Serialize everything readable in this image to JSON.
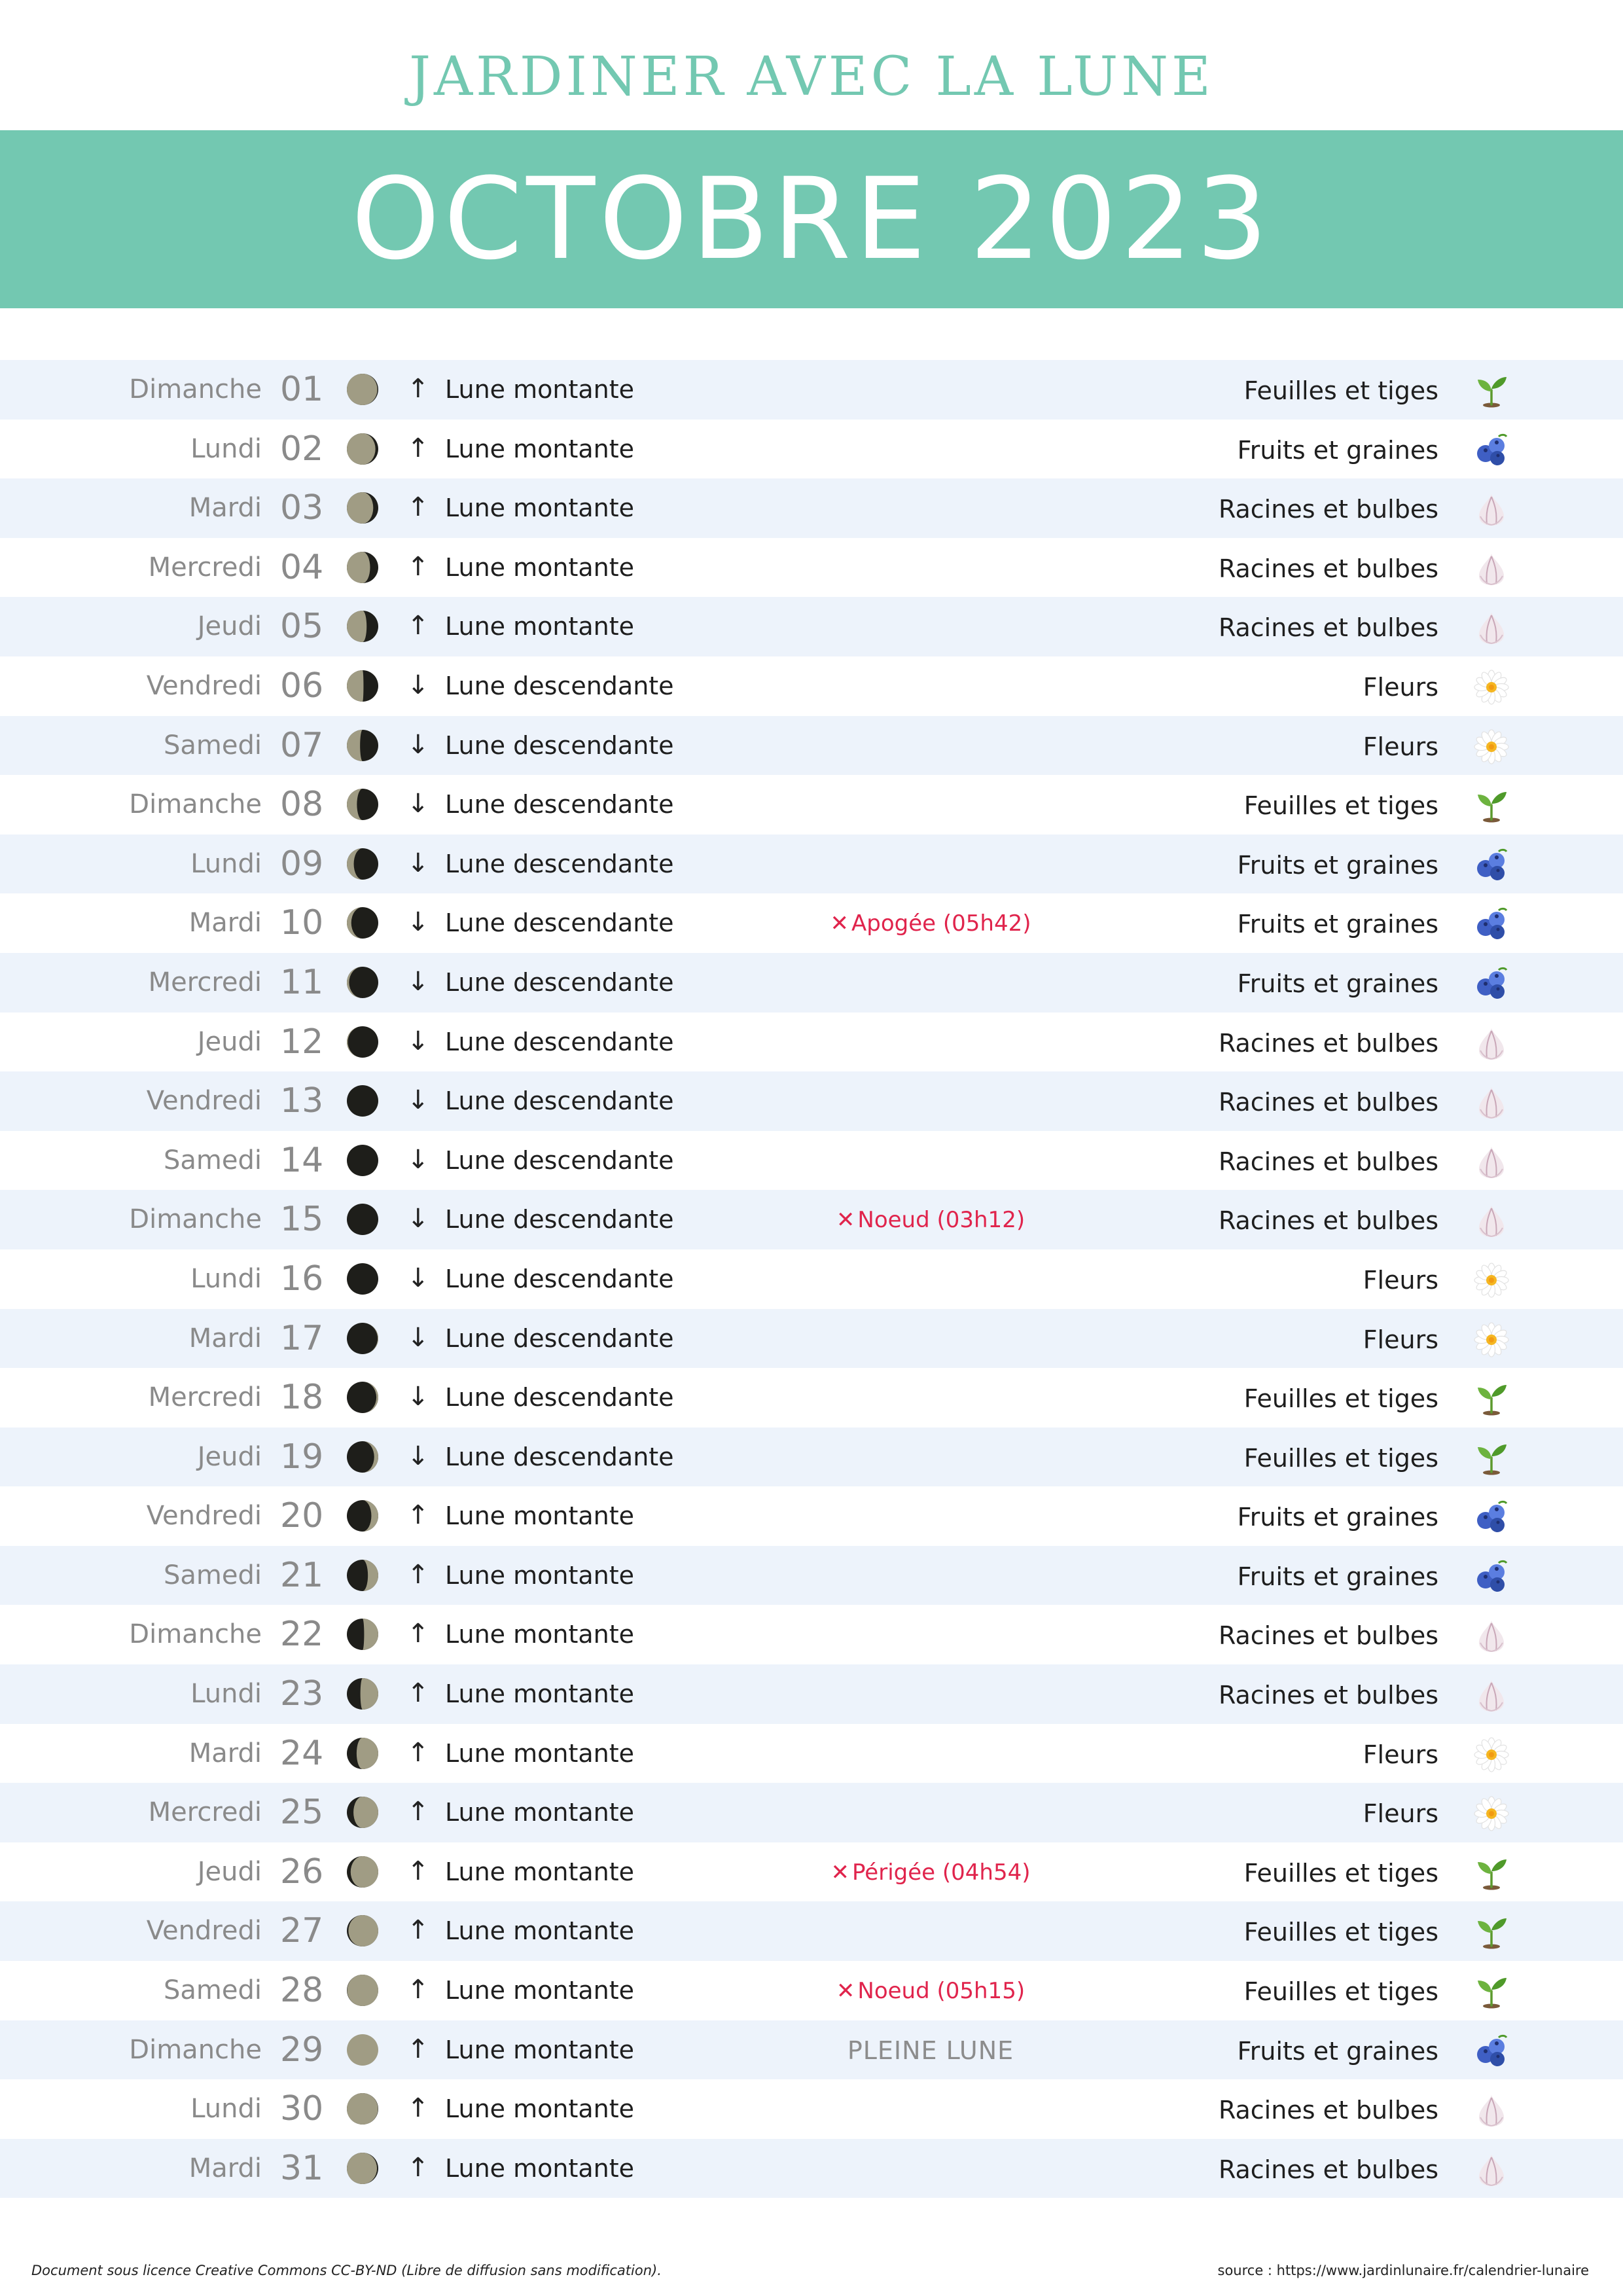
{
  "header": {
    "subtitle": "JARDINER AVEC LA LUNE",
    "title": "OCTOBRE 2023"
  },
  "colors": {
    "accent": "#73c8b1",
    "row_shade": "#edf3fb",
    "event_red": "#e0244c",
    "moon_light": "#a09c84",
    "moon_dark": "#1e1e1a"
  },
  "days": [
    {
      "weekday": "Dimanche",
      "day": "01",
      "moon_light_fraction": 0.97,
      "moon_waxing": false,
      "arrow": "↑",
      "movement": "Lune montante",
      "event": "",
      "category": "Feuilles et tiges",
      "icon": "sprout-icon"
    },
    {
      "weekday": "Lundi",
      "day": "02",
      "moon_light_fraction": 0.91,
      "moon_waxing": false,
      "arrow": "↑",
      "movement": "Lune montante",
      "event": "",
      "category": "Fruits et graines",
      "icon": "blueberries-icon"
    },
    {
      "weekday": "Mardi",
      "day": "03",
      "moon_light_fraction": 0.84,
      "moon_waxing": false,
      "arrow": "↑",
      "movement": "Lune montante",
      "event": "",
      "category": "Racines et bulbes",
      "icon": "garlic-icon"
    },
    {
      "weekday": "Mercredi",
      "day": "04",
      "moon_light_fraction": 0.74,
      "moon_waxing": false,
      "arrow": "↑",
      "movement": "Lune montante",
      "event": "",
      "category": "Racines et bulbes",
      "icon": "garlic-icon"
    },
    {
      "weekday": "Jeudi",
      "day": "05",
      "moon_light_fraction": 0.63,
      "moon_waxing": false,
      "arrow": "↑",
      "movement": "Lune montante",
      "event": "",
      "category": "Racines et bulbes",
      "icon": "garlic-icon"
    },
    {
      "weekday": "Vendredi",
      "day": "06",
      "moon_light_fraction": 0.53,
      "moon_waxing": false,
      "arrow": "↓",
      "movement": "Lune descendante",
      "event": "",
      "category": "Fleurs",
      "icon": "daisy-icon"
    },
    {
      "weekday": "Samedi",
      "day": "07",
      "moon_light_fraction": 0.42,
      "moon_waxing": false,
      "arrow": "↓",
      "movement": "Lune descendante",
      "event": "",
      "category": "Fleurs",
      "icon": "daisy-icon"
    },
    {
      "weekday": "Dimanche",
      "day": "08",
      "moon_light_fraction": 0.32,
      "moon_waxing": false,
      "arrow": "↓",
      "movement": "Lune descendante",
      "event": "",
      "category": "Feuilles et tiges",
      "icon": "sprout-icon"
    },
    {
      "weekday": "Lundi",
      "day": "09",
      "moon_light_fraction": 0.22,
      "moon_waxing": false,
      "arrow": "↓",
      "movement": "Lune descendante",
      "event": "",
      "category": "Fruits et graines",
      "icon": "blueberries-icon"
    },
    {
      "weekday": "Mardi",
      "day": "10",
      "moon_light_fraction": 0.14,
      "moon_waxing": false,
      "arrow": "↓",
      "movement": "Lune descendante",
      "event": "Apogée (05h42)",
      "category": "Fruits et graines",
      "icon": "blueberries-icon"
    },
    {
      "weekday": "Mercredi",
      "day": "11",
      "moon_light_fraction": 0.07,
      "moon_waxing": false,
      "arrow": "↓",
      "movement": "Lune descendante",
      "event": "",
      "category": "Fruits et graines",
      "icon": "blueberries-icon"
    },
    {
      "weekday": "Jeudi",
      "day": "12",
      "moon_light_fraction": 0.03,
      "moon_waxing": false,
      "arrow": "↓",
      "movement": "Lune descendante",
      "event": "",
      "category": "Racines et bulbes",
      "icon": "garlic-icon"
    },
    {
      "weekday": "Vendredi",
      "day": "13",
      "moon_light_fraction": 0.0,
      "moon_waxing": false,
      "arrow": "↓",
      "movement": "Lune descendante",
      "event": "",
      "category": "Racines et bulbes",
      "icon": "garlic-icon"
    },
    {
      "weekday": "Samedi",
      "day": "14",
      "moon_light_fraction": 0.0,
      "moon_waxing": true,
      "arrow": "↓",
      "movement": "Lune descendante",
      "event": "",
      "category": "Racines et bulbes",
      "icon": "garlic-icon"
    },
    {
      "weekday": "Dimanche",
      "day": "15",
      "moon_light_fraction": 0.0,
      "moon_waxing": true,
      "arrow": "↓",
      "movement": "Lune descendante",
      "event": "Noeud (03h12)",
      "category": "Racines et bulbes",
      "icon": "garlic-icon"
    },
    {
      "weekday": "Lundi",
      "day": "16",
      "moon_light_fraction": 0.0,
      "moon_waxing": true,
      "arrow": "↓",
      "movement": "Lune descendante",
      "event": "",
      "category": "Fleurs",
      "icon": "daisy-icon"
    },
    {
      "weekday": "Mardi",
      "day": "17",
      "moon_light_fraction": 0.02,
      "moon_waxing": true,
      "arrow": "↓",
      "movement": "Lune descendante",
      "event": "",
      "category": "Fleurs",
      "icon": "daisy-icon"
    },
    {
      "weekday": "Mercredi",
      "day": "18",
      "moon_light_fraction": 0.06,
      "moon_waxing": true,
      "arrow": "↓",
      "movement": "Lune descendante",
      "event": "",
      "category": "Feuilles et tiges",
      "icon": "sprout-icon"
    },
    {
      "weekday": "Jeudi",
      "day": "19",
      "moon_light_fraction": 0.13,
      "moon_waxing": true,
      "arrow": "↓",
      "movement": "Lune descendante",
      "event": "",
      "category": "Feuilles et tiges",
      "icon": "sprout-icon"
    },
    {
      "weekday": "Vendredi",
      "day": "20",
      "moon_light_fraction": 0.22,
      "moon_waxing": true,
      "arrow": "↑",
      "movement": "Lune montante",
      "event": "",
      "category": "Fruits et graines",
      "icon": "blueberries-icon"
    },
    {
      "weekday": "Samedi",
      "day": "21",
      "moon_light_fraction": 0.33,
      "moon_waxing": true,
      "arrow": "↑",
      "movement": "Lune montante",
      "event": "",
      "category": "Fruits et graines",
      "icon": "blueberries-icon"
    },
    {
      "weekday": "Dimanche",
      "day": "22",
      "moon_light_fraction": 0.45,
      "moon_waxing": true,
      "arrow": "↑",
      "movement": "Lune montante",
      "event": "",
      "category": "Racines et bulbes",
      "icon": "garlic-icon"
    },
    {
      "weekday": "Lundi",
      "day": "23",
      "moon_light_fraction": 0.57,
      "moon_waxing": true,
      "arrow": "↑",
      "movement": "Lune montante",
      "event": "",
      "category": "Racines et bulbes",
      "icon": "garlic-icon"
    },
    {
      "weekday": "Mardi",
      "day": "24",
      "moon_light_fraction": 0.69,
      "moon_waxing": true,
      "arrow": "↑",
      "movement": "Lune montante",
      "event": "",
      "category": "Fleurs",
      "icon": "daisy-icon"
    },
    {
      "weekday": "Mercredi",
      "day": "25",
      "moon_light_fraction": 0.79,
      "moon_waxing": true,
      "arrow": "↑",
      "movement": "Lune montante",
      "event": "",
      "category": "Fleurs",
      "icon": "daisy-icon"
    },
    {
      "weekday": "Jeudi",
      "day": "26",
      "moon_light_fraction": 0.88,
      "moon_waxing": true,
      "arrow": "↑",
      "movement": "Lune montante",
      "event": "Périgée (04h54)",
      "category": "Feuilles et tiges",
      "icon": "sprout-icon"
    },
    {
      "weekday": "Vendredi",
      "day": "27",
      "moon_light_fraction": 0.95,
      "moon_waxing": true,
      "arrow": "↑",
      "movement": "Lune montante",
      "event": "",
      "category": "Feuilles et tiges",
      "icon": "sprout-icon"
    },
    {
      "weekday": "Samedi",
      "day": "28",
      "moon_light_fraction": 0.99,
      "moon_waxing": true,
      "arrow": "↑",
      "movement": "Lune montante",
      "event": "Noeud (05h15)",
      "category": "Feuilles et tiges",
      "icon": "sprout-icon"
    },
    {
      "weekday": "Dimanche",
      "day": "29",
      "moon_light_fraction": 1.0,
      "moon_waxing": false,
      "arrow": "↑",
      "movement": "Lune montante",
      "event": "PLEINE LUNE",
      "category": "Fruits et graines",
      "icon": "blueberries-icon"
    },
    {
      "weekday": "Lundi",
      "day": "30",
      "moon_light_fraction": 0.99,
      "moon_waxing": false,
      "arrow": "↑",
      "movement": "Lune montante",
      "event": "",
      "category": "Racines et bulbes",
      "icon": "garlic-icon"
    },
    {
      "weekday": "Mardi",
      "day": "31",
      "moon_light_fraction": 0.96,
      "moon_waxing": false,
      "arrow": "↑",
      "movement": "Lune montante",
      "event": "",
      "category": "Racines et bulbes",
      "icon": "garlic-icon"
    }
  ],
  "footer": {
    "license": "Document sous licence Creative Commons CC-BY-ND (Libre de diffusion sans modification).",
    "source": "source : https://www.jardinlunaire.fr/calendrier-lunaire"
  }
}
